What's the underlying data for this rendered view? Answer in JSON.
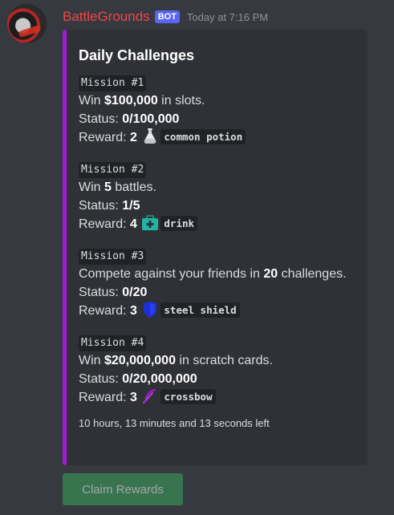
{
  "message": {
    "username": "BattleGrounds",
    "bot_tag": "BOT",
    "timestamp": "Today at 7:16 PM"
  },
  "embed": {
    "accent_color": "#a01bd6",
    "title": "Daily Challenges",
    "missions": [
      {
        "label": "Mission #1",
        "desc_prefix": "Win ",
        "desc_value": "$100,000",
        "desc_suffix": " in slots.",
        "status_label": "Status: ",
        "status_value": "0/100,000",
        "reward_label": "Reward: ",
        "reward_count": "2",
        "reward_icon": "potion-icon",
        "reward_item": "common potion"
      },
      {
        "label": "Mission #2",
        "desc_prefix": "Win ",
        "desc_value": "5",
        "desc_suffix": " battles.",
        "status_label": "Status: ",
        "status_value": "1/5",
        "reward_label": "Reward: ",
        "reward_count": "4",
        "reward_icon": "medkit-icon",
        "reward_item": "drink"
      },
      {
        "label": "Mission #3",
        "desc_prefix": "Compete against your friends in ",
        "desc_value": "20",
        "desc_suffix": " challenges.",
        "status_label": "Status: ",
        "status_value": "0/20",
        "reward_label": "Reward: ",
        "reward_count": "3",
        "reward_icon": "shield-icon",
        "reward_item": "steel shield"
      },
      {
        "label": "Mission #4",
        "desc_prefix": "Win ",
        "desc_value": "$20,000,000",
        "desc_suffix": " in scratch cards.",
        "status_label": "Status: ",
        "status_value": "0/20,000,000",
        "reward_label": "Reward: ",
        "reward_count": "3",
        "reward_icon": "crossbow-icon",
        "reward_item": "crossbow"
      }
    ],
    "footer": "10 hours, 13 minutes and 13 seconds left"
  },
  "button": {
    "label": "Claim Rewards",
    "color": "#3ba55c",
    "state": "disabled"
  }
}
